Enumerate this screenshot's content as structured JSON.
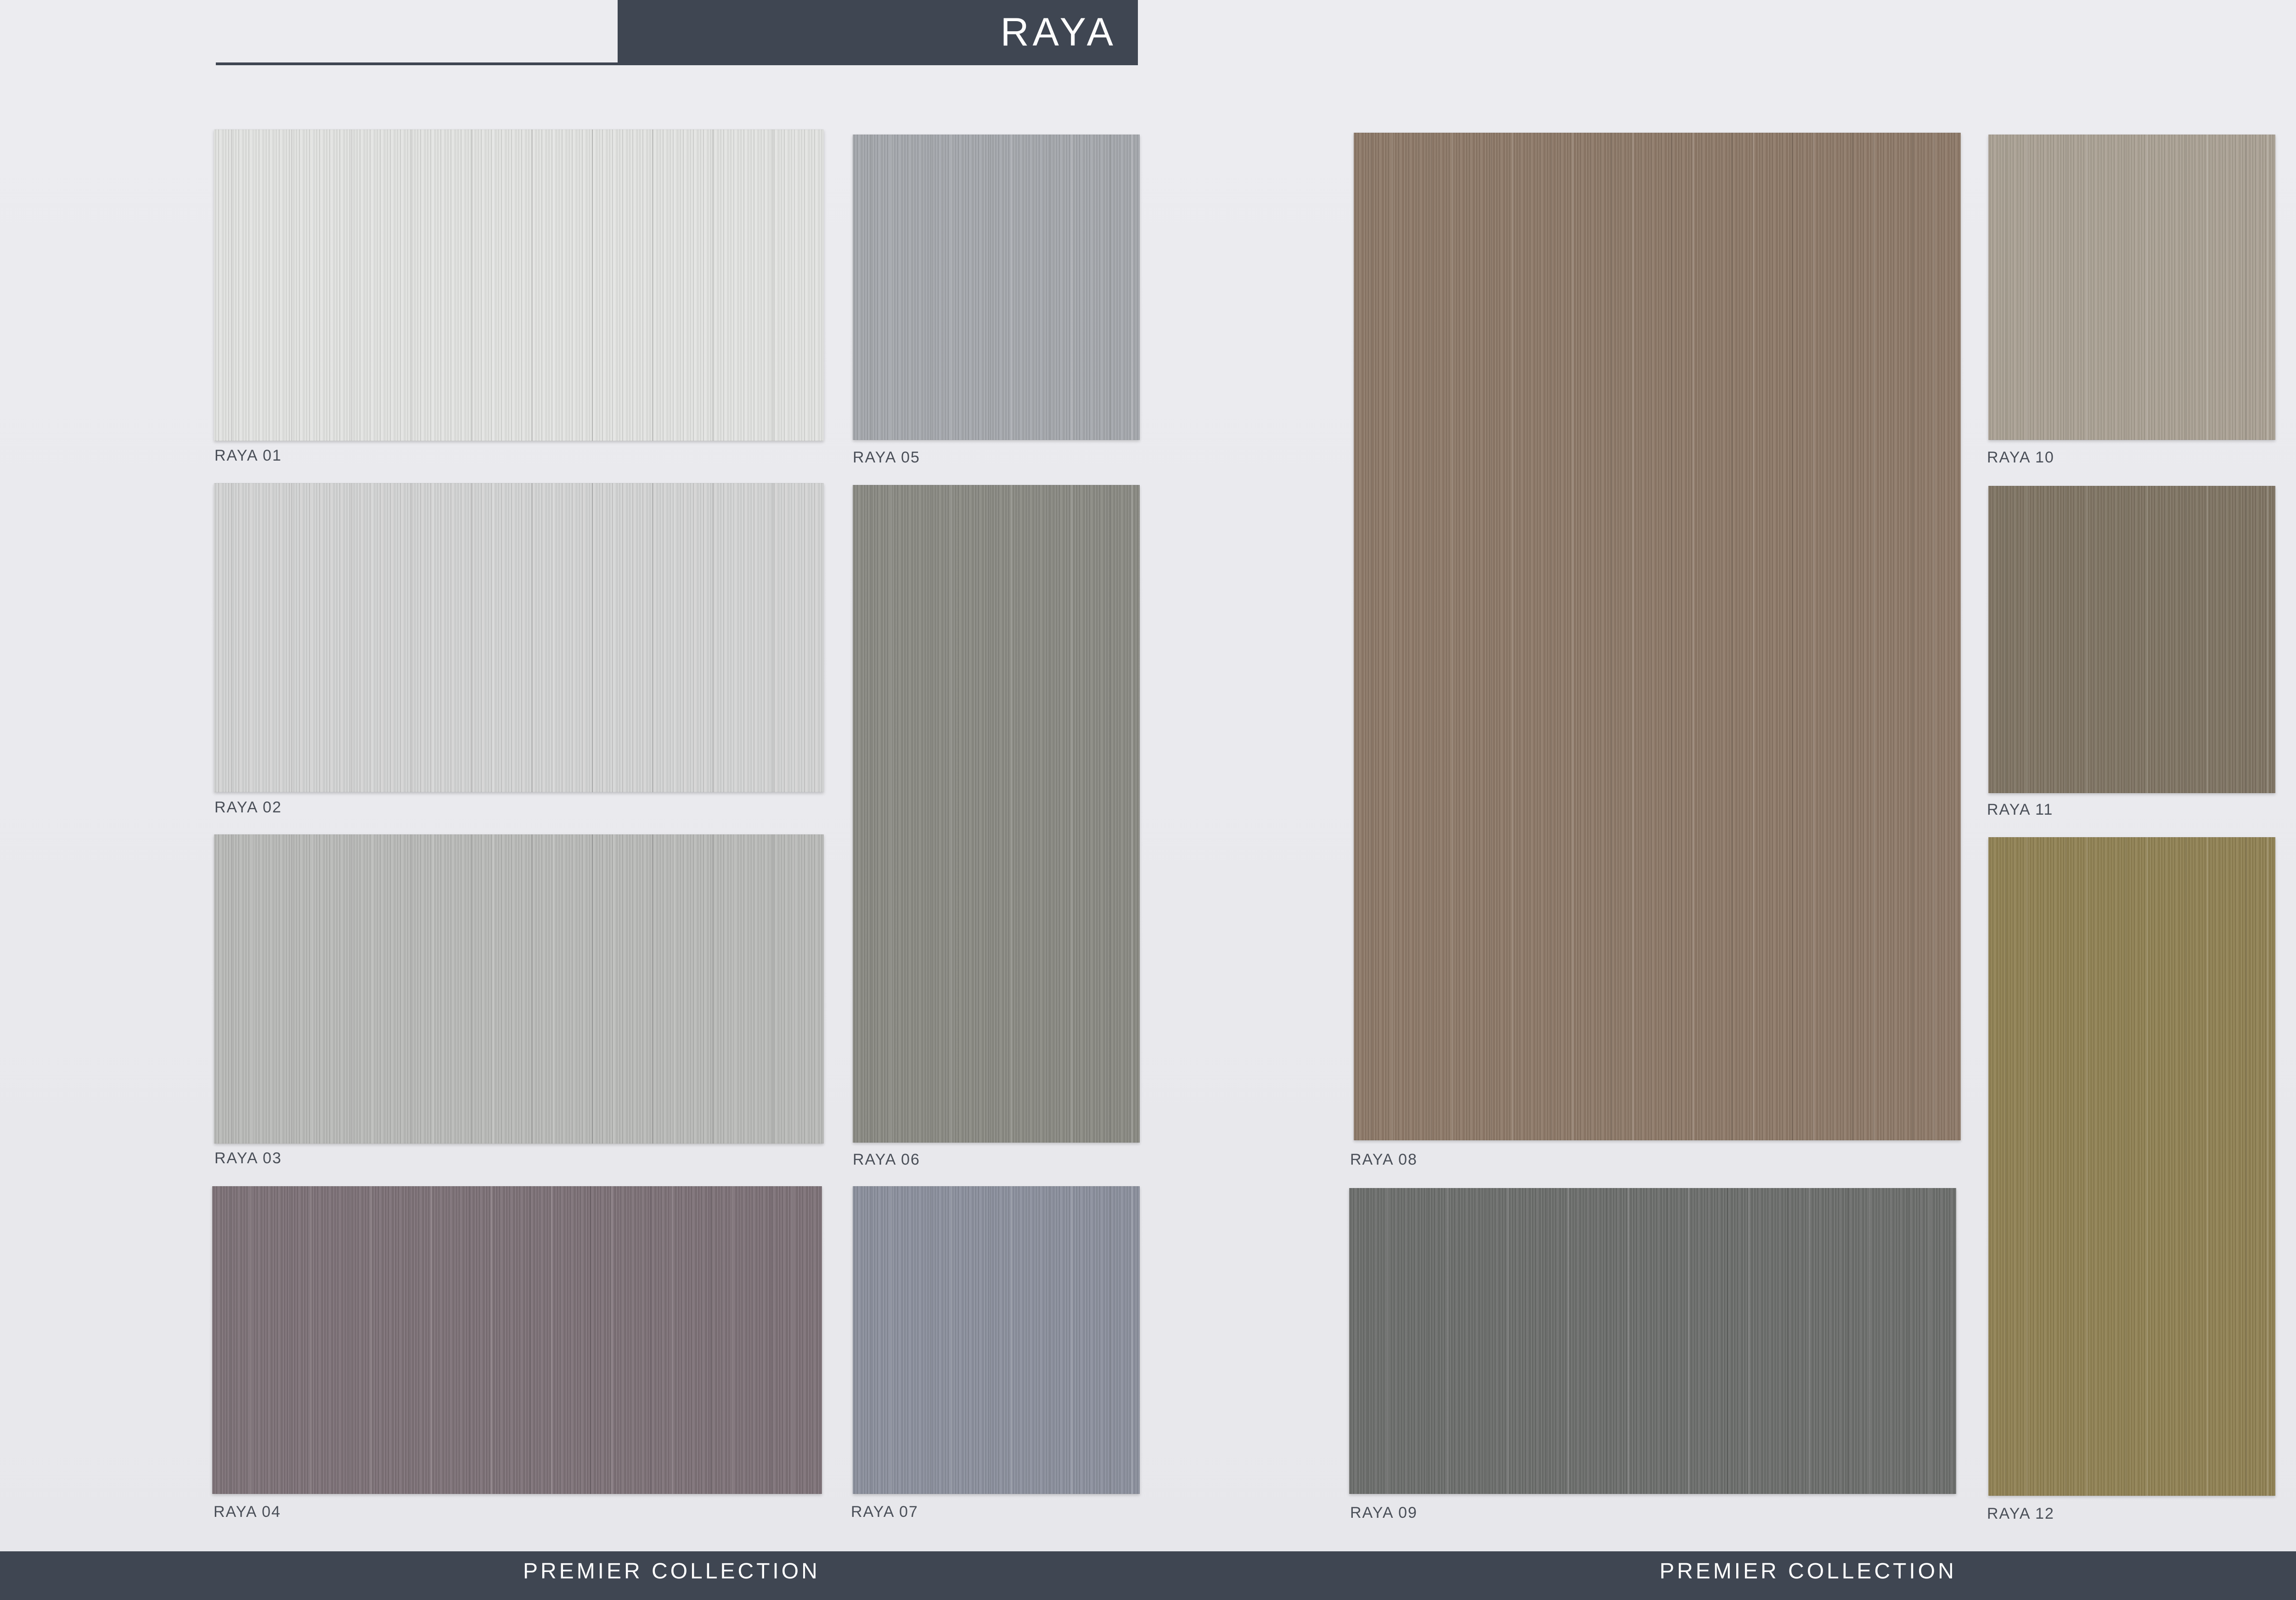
{
  "header": {
    "title": "RAYA"
  },
  "swatches": [
    {
      "label": "RAYA 01",
      "color": "#e2e3e1"
    },
    {
      "label": "RAYA 02",
      "color": "#d3d4d4"
    },
    {
      "label": "RAYA 03",
      "color": "#b9bab8"
    },
    {
      "label": "RAYA 04",
      "color": "#7d7177"
    },
    {
      "label": "RAYA 05",
      "color": "#a5a8ad"
    },
    {
      "label": "RAYA 06",
      "color": "#8a8a83"
    },
    {
      "label": "RAYA 07",
      "color": "#8b909d"
    },
    {
      "label": "RAYA 08",
      "color": "#8d7968"
    },
    {
      "label": "RAYA 09",
      "color": "#6c6e6c"
    },
    {
      "label": "RAYA 10",
      "color": "#aaa194"
    },
    {
      "label": "RAYA 11",
      "color": "#7f7463"
    },
    {
      "label": "RAYA 12",
      "color": "#908153"
    }
  ],
  "footer": {
    "left_text": "PREMIER COLLECTION",
    "right_text": "PREMIER COLLECTION"
  }
}
